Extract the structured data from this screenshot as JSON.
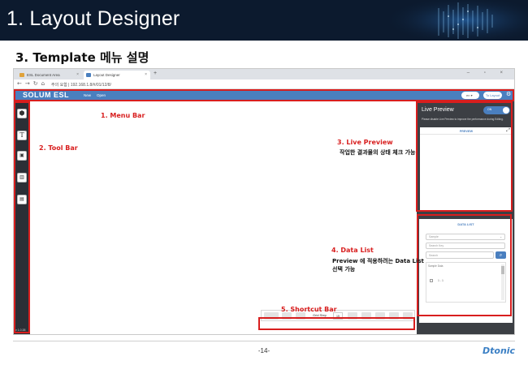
{
  "slide": {
    "title": "1. Layout Designer",
    "section_heading": "3. Template 메뉴 설명",
    "page_number": "-14-",
    "brand": "Dtonic"
  },
  "browser": {
    "tabs": [
      {
        "label": "ESL Document Area",
        "active": false
      },
      {
        "label": "Layout Designer",
        "active": true
      }
    ],
    "new_tab": "+",
    "window_controls": "– ▫ ×",
    "url": "주의 요함 | 192.168.1.8/#/01/12/8/"
  },
  "app": {
    "logo": "SOLUM ESL",
    "menu": {
      "new": "New",
      "open": "Open"
    },
    "lang": "en",
    "to_layout": "To Layout",
    "version": "v 1.0.38",
    "live_preview": {
      "title": "Live Preview",
      "toggle": "ON",
      "note": "Please disable Live Preview to improve the performance during Editing.",
      "box_head": "PREVIEW"
    },
    "data_list": {
      "title": "DATA LIST",
      "select_placeholder": "Sample",
      "key_placeholder": "Search Key",
      "search_placeholder": "Search",
      "col_head": "Sample Data",
      "row": "1 - 1"
    },
    "shortcut_bar": {
      "grid_label": "Grid Step",
      "grid_value": "15"
    }
  },
  "annotations": {
    "menu_bar": "1. Menu Bar",
    "tool_bar": "2. Tool Bar",
    "live_preview": "3. Live Preview",
    "live_preview_desc": "작업한 결과물의 상태 체크 가능",
    "data_list": "4. Data List",
    "data_list_desc_1": "Preview 에 적용하려는 Data List",
    "data_list_desc_2": "선택 가능",
    "shortcut_bar": "5. Shortcut Bar"
  },
  "colors": {
    "header_bg": "#0c1a2e",
    "app_blue": "#4a7fbf",
    "callout_red": "#d81e1e",
    "toolbar_dark": "#2b2f36",
    "panel_dark": "#3c3f44"
  }
}
